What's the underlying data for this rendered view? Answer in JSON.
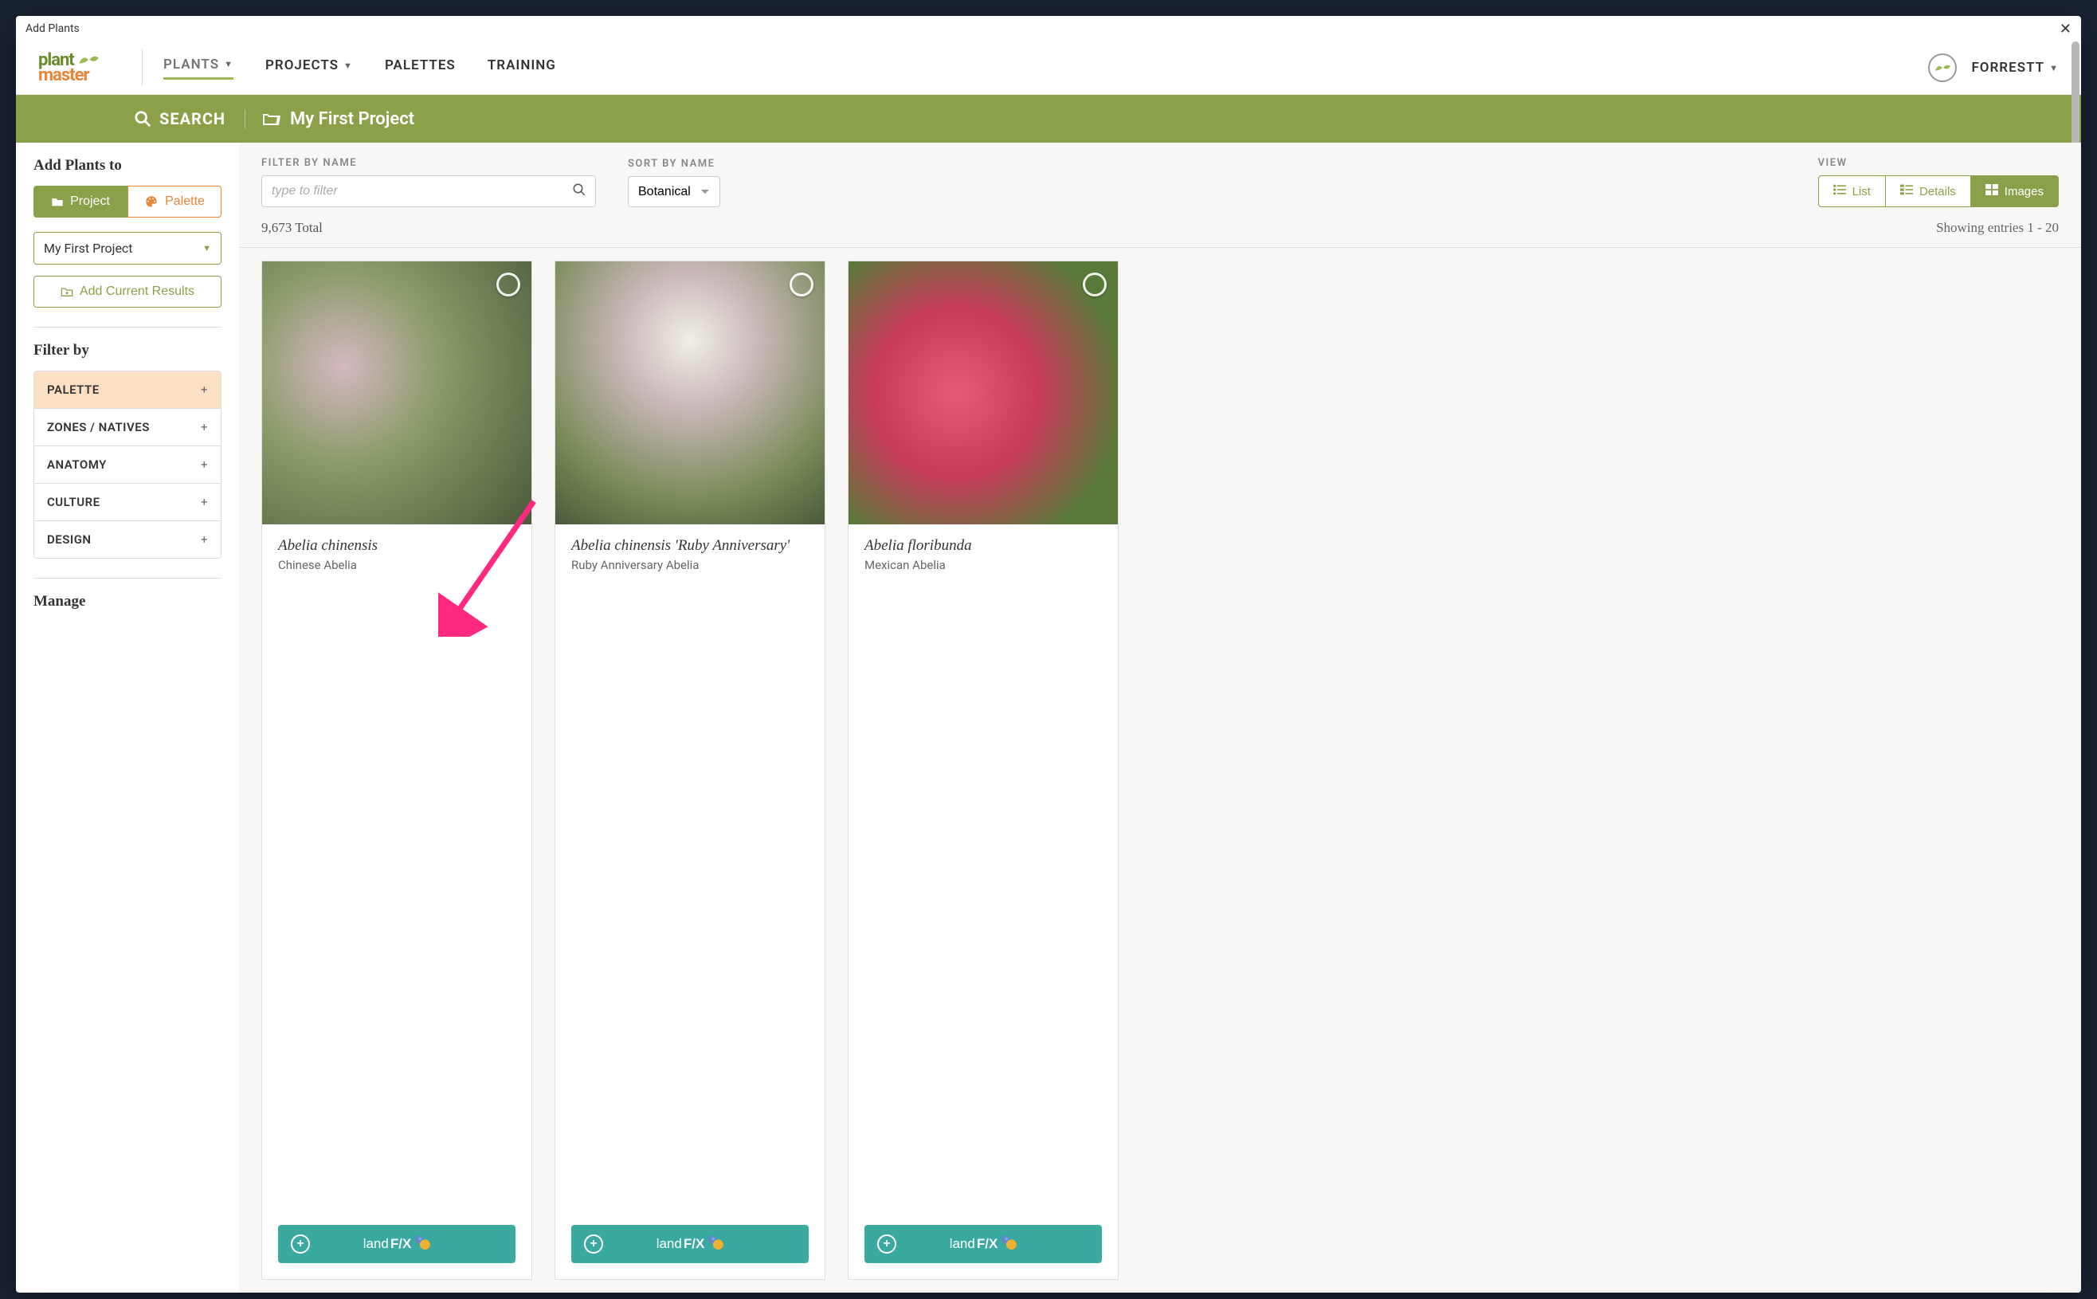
{
  "dialog": {
    "title": "Add Plants"
  },
  "nav": {
    "items": [
      {
        "label": "PLANTS",
        "has_caret": true,
        "active": true
      },
      {
        "label": "PROJECTS",
        "has_caret": true,
        "active": false
      },
      {
        "label": "PALETTES",
        "has_caret": false,
        "active": false
      },
      {
        "label": "TRAINING",
        "has_caret": false,
        "active": false
      }
    ],
    "user": "FORRESTT"
  },
  "greenbar": {
    "search_label": "SEARCH",
    "project_label": "My First Project"
  },
  "sidebar": {
    "add_plants_heading": "Add Plants to",
    "project_btn": "Project",
    "palette_btn": "Palette",
    "project_select": "My First Project",
    "add_current": "Add Current Results",
    "filter_heading": "Filter by",
    "filters": [
      {
        "label": "PALETTE",
        "active": true
      },
      {
        "label": "ZONES / NATIVES",
        "active": false
      },
      {
        "label": "ANATOMY",
        "active": false
      },
      {
        "label": "CULTURE",
        "active": false
      },
      {
        "label": "DESIGN",
        "active": false
      }
    ],
    "manage_heading": "Manage"
  },
  "content": {
    "filter_label": "FILTER BY NAME",
    "filter_placeholder": "type to filter",
    "sort_label": "SORT BY NAME",
    "sort_value": "Botanical",
    "view_label": "VIEW",
    "view_buttons": [
      {
        "label": "List",
        "active": false,
        "icon": "list"
      },
      {
        "label": "Details",
        "active": false,
        "icon": "details"
      },
      {
        "label": "Images",
        "active": true,
        "icon": "grid"
      }
    ],
    "total": "9,673 Total",
    "showing": "Showing entries 1 - 20",
    "landfx_label_a": "land ",
    "landfx_label_b": "F/X",
    "cards": [
      {
        "title": "Abelia chinensis",
        "subtitle": "Chinese Abelia",
        "img": "img1"
      },
      {
        "title": "Abelia chinensis 'Ruby Anniversary'",
        "subtitle": "Ruby Anniversary Abelia",
        "img": "img2"
      },
      {
        "title": "Abelia floribunda",
        "subtitle": "Mexican Abelia",
        "img": "img3"
      }
    ]
  }
}
